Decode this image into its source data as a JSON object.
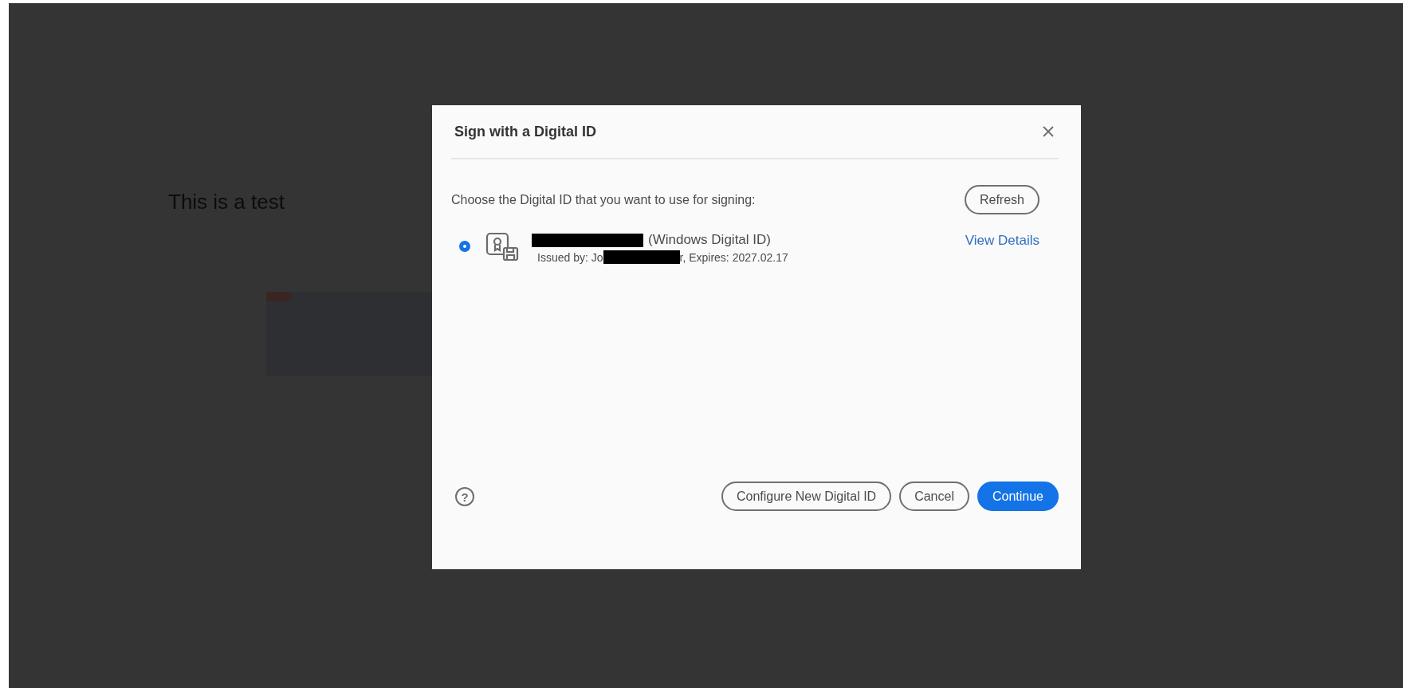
{
  "document": {
    "text": "This is a test"
  },
  "dialog": {
    "title": "Sign with a Digital ID",
    "instruction": "Choose the Digital ID that you want to use for signing:",
    "refresh": "Refresh",
    "ids": [
      {
        "selected": true,
        "name_suffix": "(Windows Digital ID)",
        "issued_prefix": "Issued by: Jo",
        "issued_suffix": "r, Expires: 2027.02.17",
        "link": "View Details"
      }
    ],
    "help": "?",
    "buttons": [
      {
        "label": "Configure New Digital ID",
        "kind": "secondary"
      },
      {
        "label": "Cancel",
        "kind": "secondary"
      },
      {
        "label": "Continue",
        "kind": "primary"
      }
    ]
  }
}
